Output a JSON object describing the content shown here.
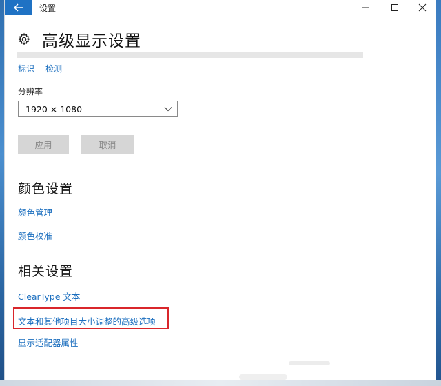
{
  "window": {
    "title": "设置",
    "back_icon": "arrow-left-icon",
    "minimize_icon": "minimize-icon",
    "maximize_icon": "maximize-icon",
    "close_icon": "close-icon",
    "accent_color": "#1f72c4"
  },
  "header": {
    "icon": "gear-icon",
    "title": "高级显示设置"
  },
  "display": {
    "identify_link": "标识",
    "detect_link": "检测",
    "resolution_label": "分辨率",
    "resolution_value": "1920 × 1080",
    "apply_button": "应用",
    "cancel_button": "取消"
  },
  "color_settings": {
    "title": "颜色设置",
    "links": [
      "颜色管理",
      "颜色校准"
    ]
  },
  "related_settings": {
    "title": "相关设置",
    "links": [
      "ClearType 文本",
      "文本和其他项目大小调整的高级选项",
      "显示适配器属性"
    ],
    "highlighted_link_color": "#d9262b"
  }
}
